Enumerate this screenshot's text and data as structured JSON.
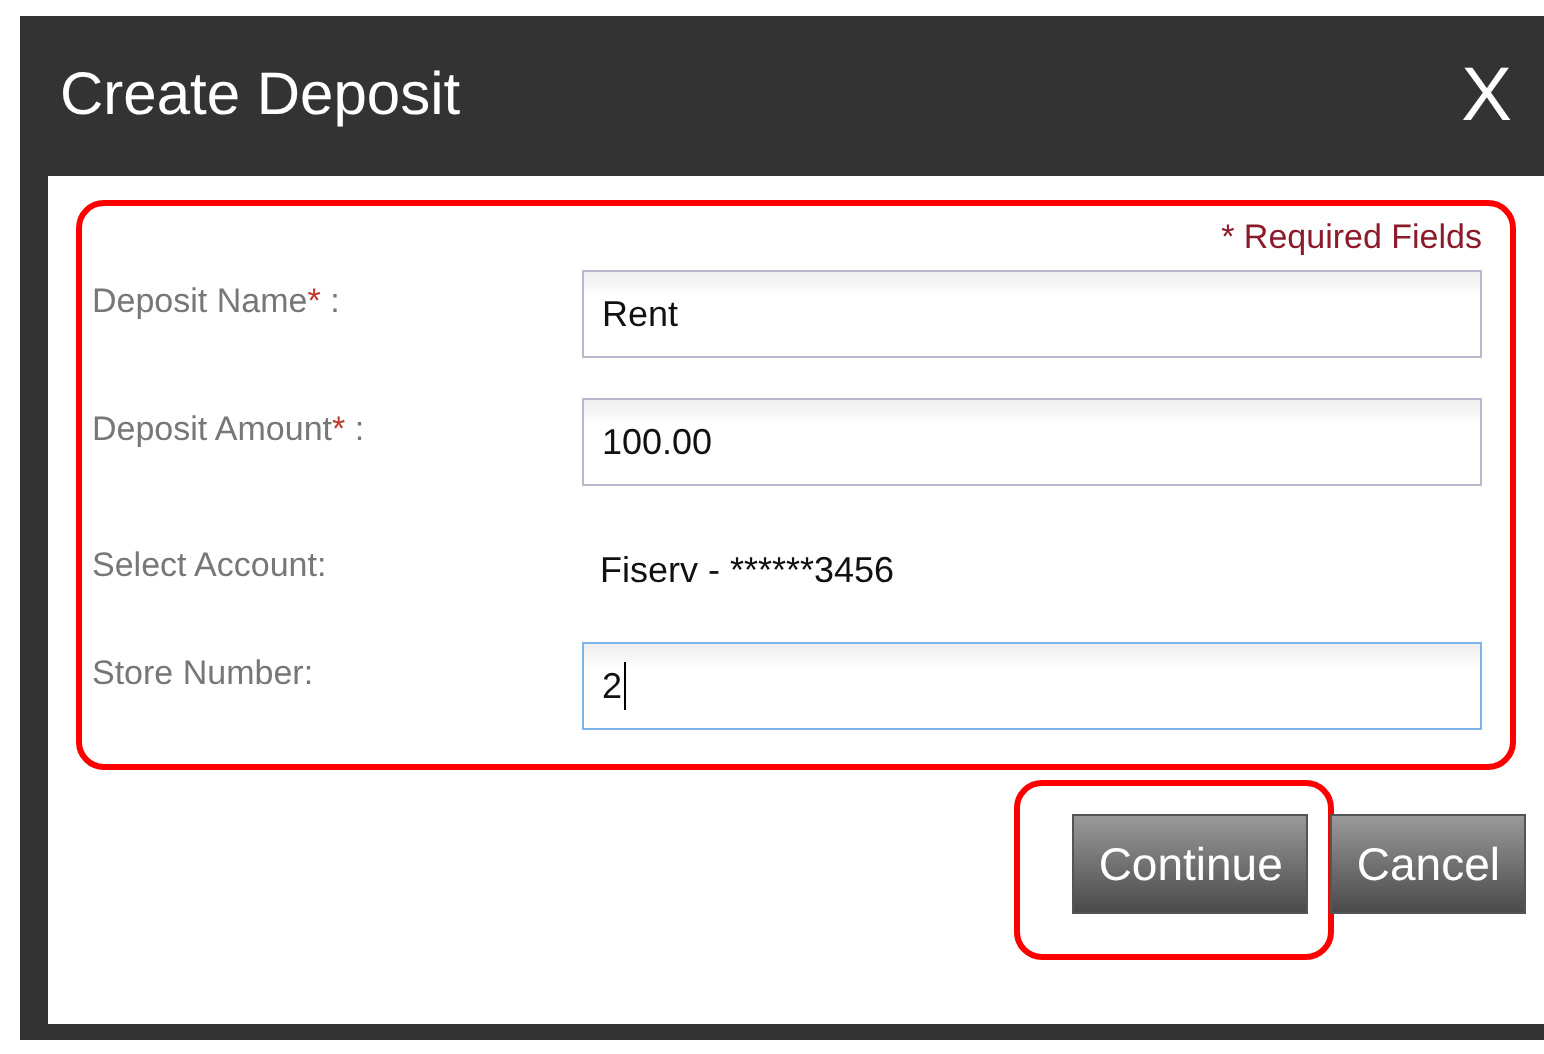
{
  "window": {
    "title": "Create Deposit",
    "close": "X"
  },
  "form": {
    "highlighted": true,
    "required_note": "* Required Fields",
    "rows": [
      {
        "kind": "input",
        "label": "Deposit Name",
        "mark": "*",
        "suffix": " :",
        "value": "Rent",
        "focused": false
      },
      {
        "kind": "input",
        "label": "Deposit Amount",
        "mark": "*",
        "suffix": " :",
        "value": "100.00",
        "focused": false
      },
      {
        "kind": "text",
        "label": "Select Account:",
        "value": "Fiserv - ******3456"
      },
      {
        "kind": "input",
        "label": "Store Number:",
        "value": "2",
        "focused": true
      }
    ]
  },
  "buttons": [
    {
      "label": "Continue",
      "highlighted": true
    },
    {
      "label": "Cancel",
      "highlighted": false
    }
  ]
}
